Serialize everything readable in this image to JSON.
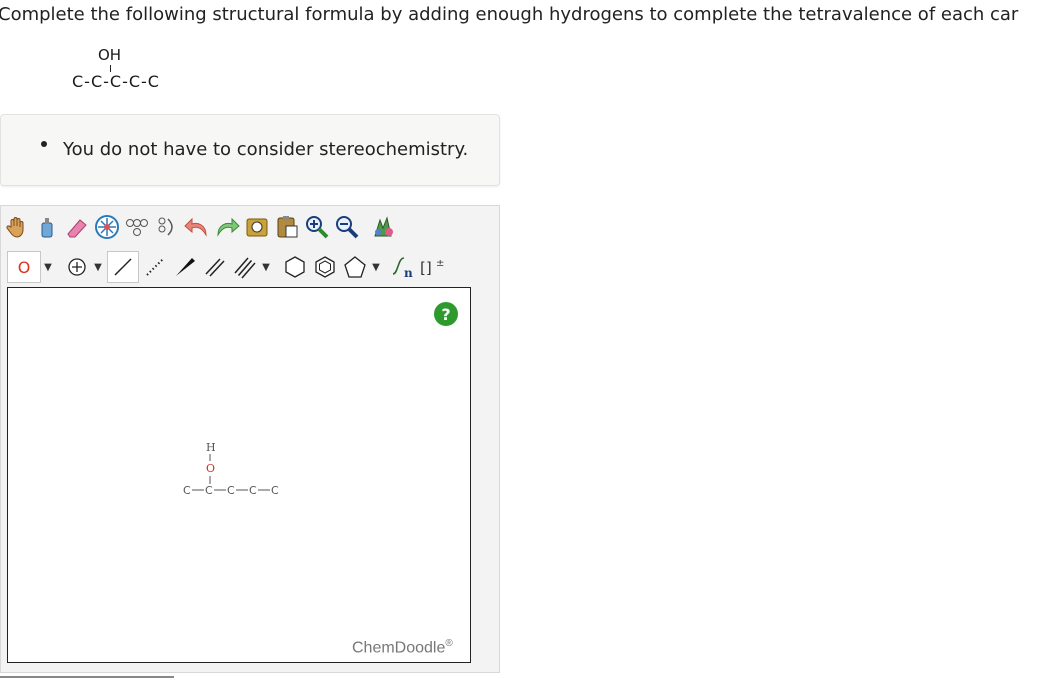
{
  "question": {
    "text": "Complete the following structural formula by adding enough hydrogens to complete the tetravalence of each car"
  },
  "formula": {
    "oh_label": "OH",
    "chain": "C-C-C-C-C"
  },
  "hint": {
    "text": "You do not have to consider stereochemistry."
  },
  "editor": {
    "element_selected": "O",
    "help_label": "?",
    "brand": "ChemDoodle",
    "brand_mark": "®",
    "molecule": {
      "h_label": "H",
      "o_label": "O",
      "chain_labels": [
        "C",
        "C",
        "C",
        "C",
        "C"
      ]
    },
    "toolbar_row1_icons": [
      "hand-icon",
      "lasso-icon",
      "eraser-icon",
      "center-icon",
      "clean-icon",
      "perspective-icon",
      "undo-icon",
      "redo-icon",
      "copy-icon",
      "paste-icon",
      "zoom-in-icon",
      "zoom-out-icon",
      "settings-icon"
    ],
    "toolbar_row2_icons": [
      "charge-icon",
      "single-bond-icon",
      "dotted-bond-icon",
      "wedge-bond-icon",
      "double-bond-icon",
      "triple-bond-icon",
      "cyclohexane-icon",
      "benzene-icon",
      "cyclopentane-icon",
      "repeat-unit-icon",
      "bracket-icon"
    ],
    "brackets_label": "[]",
    "charge_mark": "±",
    "repeat_label": "n"
  },
  "colors": {
    "accent_green": "#2e9a2e",
    "element_red": "#e03020"
  }
}
